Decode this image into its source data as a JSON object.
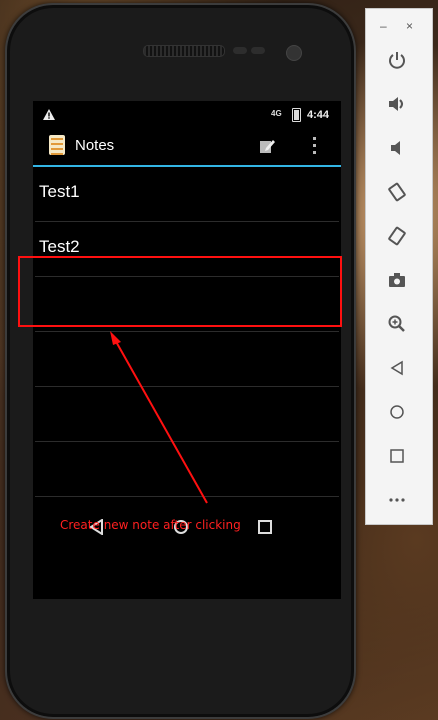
{
  "statusbar": {
    "network": "4G",
    "time": "4:44"
  },
  "actionbar": {
    "title": "Notes"
  },
  "notes": [
    {
      "label": "Test1"
    },
    {
      "label": "Test2"
    },
    {
      "label": ""
    },
    {
      "label": ""
    },
    {
      "label": ""
    },
    {
      "label": ""
    }
  ],
  "annotation": {
    "text": "Create new note after clicking"
  },
  "colors": {
    "accent": "#33b5e5",
    "highlight": "#ff1010"
  },
  "sidebar": {
    "window_controls": [
      "–",
      "×"
    ],
    "buttons": [
      "power-icon",
      "volume-up-icon",
      "volume-down-icon",
      "rotate-left-icon",
      "rotate-right-icon",
      "camera-icon",
      "zoom-icon",
      "back-icon",
      "home-icon",
      "overview-icon",
      "more-icon"
    ]
  }
}
